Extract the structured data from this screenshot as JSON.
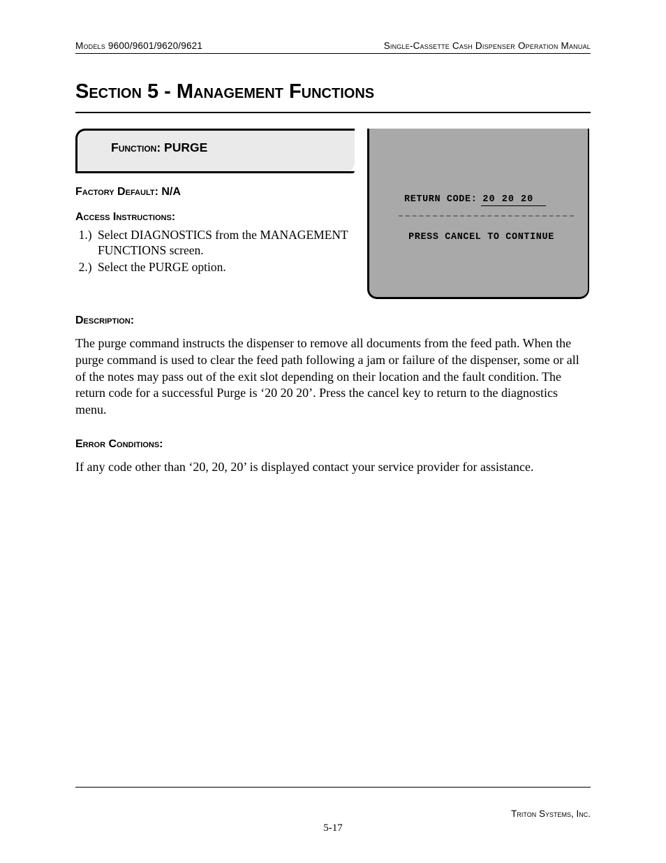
{
  "header": {
    "left": "Models 9600/9601/9620/9621",
    "right": "Single-Cassette Cash Dispenser Operation Manual"
  },
  "title": "Section 5 - Management Functions",
  "function": {
    "label": "Function: ",
    "name": "PURGE"
  },
  "factory_default": {
    "label": "Factory Default: ",
    "value": "N/A"
  },
  "access": {
    "label": "Access Instructions:",
    "steps": [
      "Select DIAGNOSTICS from the MANAGEMENT FUNCTIONS screen.",
      "Select the PURGE option."
    ]
  },
  "screen": {
    "return_code_label": "RETURN CODE:",
    "return_code_value": "20 20 20",
    "continue_prompt": "PRESS CANCEL TO CONTINUE"
  },
  "description": {
    "label": "Description:",
    "text": "The purge command instructs the dispenser to remove all documents from the feed path.  When the purge command is used to clear the feed path following a jam or failure of the dispenser, some or all of the notes may pass out of the exit slot depending on their location and the fault condition.  The return code for a successful Purge is ‘20 20 20’. Press the cancel key to return to the diagnostics menu."
  },
  "error": {
    "label": "Error Conditions:",
    "text": "If any code other than ‘20, 20, 20’ is displayed contact your service provider for assistance."
  },
  "footer": {
    "company": "Triton Systems, Inc.",
    "page": "5-17"
  }
}
